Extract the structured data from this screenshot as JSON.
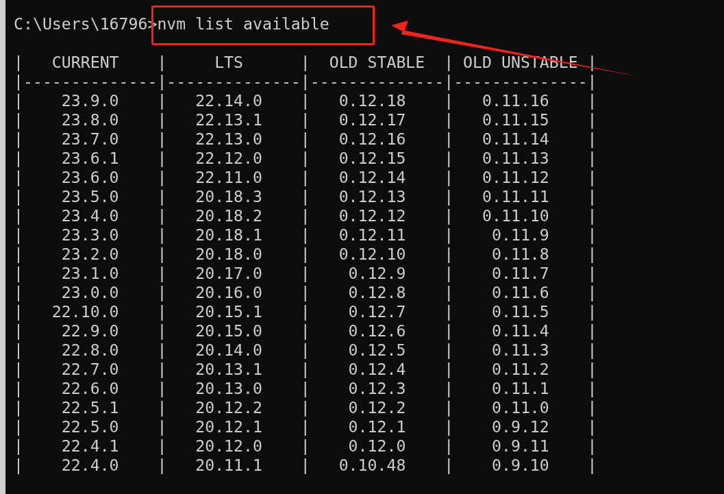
{
  "terminal": {
    "prompt_line": "C:\\Users\\16796>nvm list available",
    "output_lines": [
      "|   CURRENT    |     LTS      |  OLD STABLE  | OLD UNSTABLE |",
      "|--------------|--------------|--------------|--------------|",
      "|    23.9.0    |   22.14.0    |   0.12.18    |   0.11.16    |",
      "|    23.8.0    |   22.13.1    |   0.12.17    |   0.11.15    |",
      "|    23.7.0    |   22.13.0    |   0.12.16    |   0.11.14    |",
      "|    23.6.1    |   22.12.0    |   0.12.15    |   0.11.13    |",
      "|    23.6.0    |   22.11.0    |   0.12.14    |   0.11.12    |",
      "|    23.5.0    |   20.18.3    |   0.12.13    |   0.11.11    |",
      "|    23.4.0    |   20.18.2    |   0.12.12    |   0.11.10    |",
      "|    23.3.0    |   20.18.1    |   0.12.11    |    0.11.9    |",
      "|    23.2.0    |   20.18.0    |   0.12.10    |    0.11.8    |",
      "|    23.1.0    |   20.17.0    |    0.12.9    |    0.11.7    |",
      "|    23.0.0    |   20.16.0    |    0.12.8    |    0.11.6    |",
      "|   22.10.0    |   20.15.1    |    0.12.7    |    0.11.5    |",
      "|    22.9.0    |   20.15.0    |    0.12.6    |    0.11.4    |",
      "|    22.8.0    |   20.14.0    |    0.12.5    |    0.11.3    |",
      "|    22.7.0    |   20.13.1    |    0.12.4    |    0.11.2    |",
      "|    22.6.0    |   20.13.0    |    0.12.3    |    0.11.1    |",
      "|    22.5.1    |   20.12.2    |    0.12.2    |    0.11.0    |",
      "|    22.5.0    |   20.12.1    |    0.12.1    |    0.9.12    |",
      "|    22.4.1    |   20.12.0    |    0.12.0    |    0.9.11    |",
      "|    22.4.0    |   20.11.1    |   0.10.48    |    0.9.10    |"
    ]
  }
}
